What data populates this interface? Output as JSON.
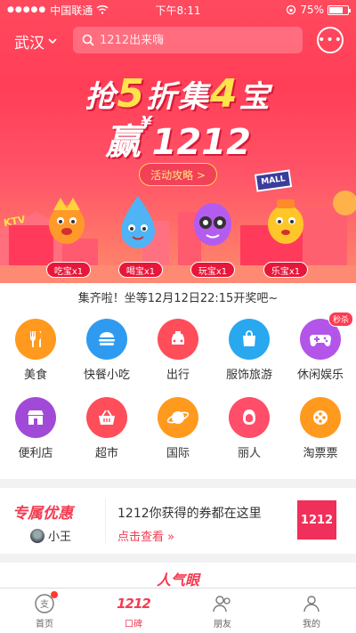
{
  "status_bar": {
    "carrier": "中国联通",
    "time": "下午8:11",
    "battery_percent": "75%",
    "battery_level": 0.75
  },
  "header": {
    "city": "武汉",
    "search_placeholder": "1212出来嗨",
    "more_icon": "ellipsis-icon"
  },
  "hero": {
    "headline_line1_parts": [
      "抢",
      "5",
      "折集",
      "4",
      "宝"
    ],
    "headline_line2_prefix": "赢",
    "headline_line2_currency": "¥",
    "headline_line2_number": "1212",
    "guide_button": "活动攻略 >",
    "mall_sign": "MALL",
    "ktv_sign": "KTV",
    "badges": [
      "吃宝x1",
      "喝宝x1",
      "玩宝x1",
      "乐宝x1"
    ],
    "accent_color": "#ff3e57"
  },
  "countdown_text": "集齐啦！坐等12月12日22:15开奖吧~",
  "categories": [
    {
      "label": "美食",
      "icon": "cutlery-icon",
      "color": "#ff9a1f"
    },
    {
      "label": "快餐小吃",
      "icon": "burger-icon",
      "color": "#2f9bf0"
    },
    {
      "label": "出行",
      "icon": "taxi-icon",
      "color": "#ff4d5a"
    },
    {
      "label": "服饰旅游",
      "icon": "shopping-bag-icon",
      "color": "#29a8f0"
    },
    {
      "label": "休闲娱乐",
      "icon": "gamepad-icon",
      "color": "#b355e8",
      "tag": "秒杀"
    },
    {
      "label": "便利店",
      "icon": "store-icon",
      "color": "#a24ad8"
    },
    {
      "label": "超市",
      "icon": "basket-icon",
      "color": "#ff4d5a"
    },
    {
      "label": "国际",
      "icon": "planet-icon",
      "color": "#ff9a1f"
    },
    {
      "label": "丽人",
      "icon": "woman-icon",
      "color": "#ff4d6a"
    },
    {
      "label": "淘票票",
      "icon": "film-reel-icon",
      "color": "#ff9a1f"
    }
  ],
  "coupon": {
    "brand": "专属优惠",
    "user_name": "小王",
    "line1": "1212你获得的券都在这里",
    "line2": "点击查看 »",
    "logo_text": "1212"
  },
  "next_section_title": "人气眼",
  "tabs": [
    {
      "label": "首页",
      "icon": "home-icon",
      "active": false,
      "dot": true
    },
    {
      "label": "口碑",
      "icon": "koubei-1212-icon",
      "active": true,
      "logo": "1212"
    },
    {
      "label": "朋友",
      "icon": "friends-icon",
      "active": false
    },
    {
      "label": "我的",
      "icon": "profile-icon",
      "active": false
    }
  ]
}
